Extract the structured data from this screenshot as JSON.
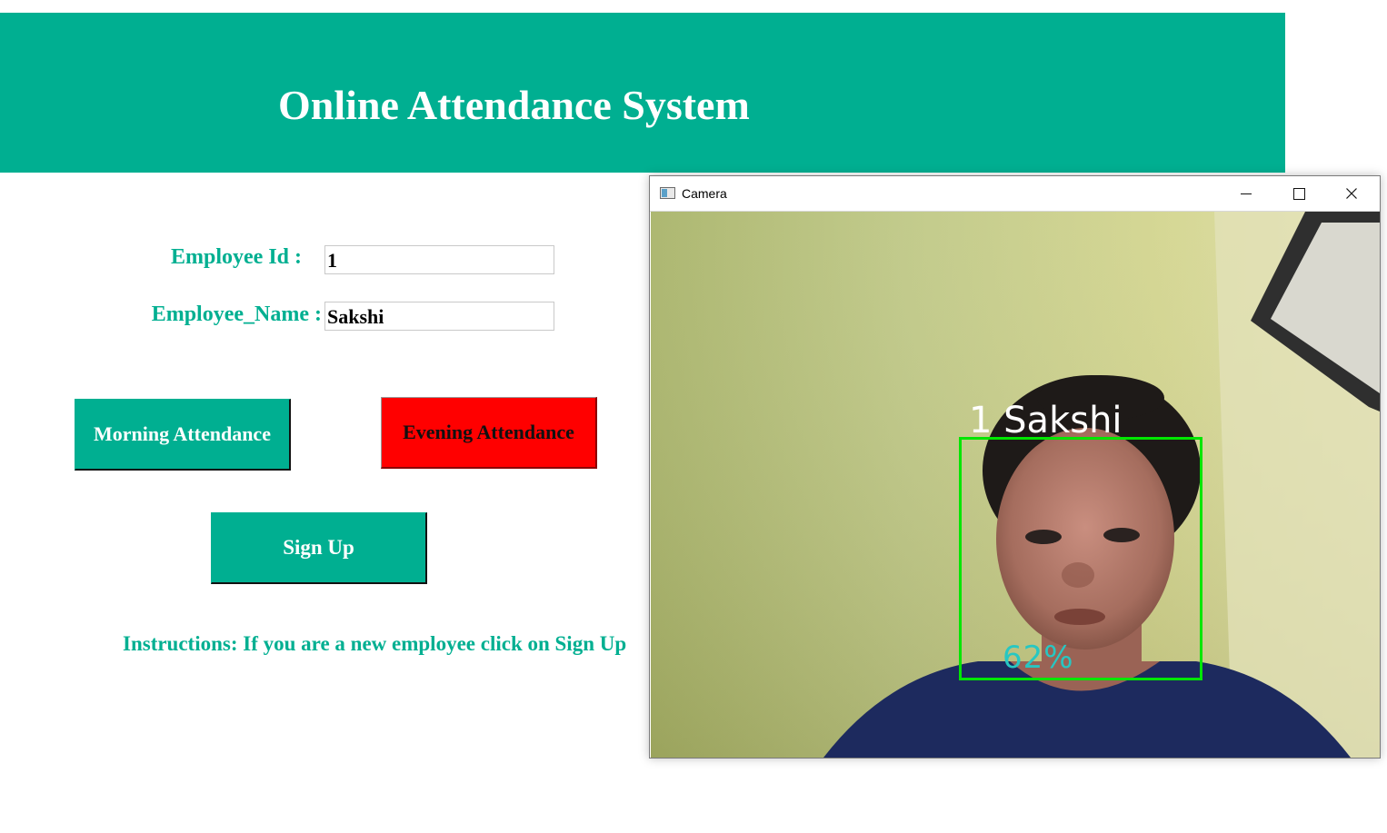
{
  "header": {
    "title": "Online Attendance System"
  },
  "form": {
    "employee_id_label": "Employee Id :",
    "employee_id_value": "1",
    "employee_name_label": "Employee_Name :",
    "employee_name_value": "Sakshi"
  },
  "buttons": {
    "morning": "Morning Attendance",
    "evening": "Evening Attendance",
    "signup": "Sign Up"
  },
  "instructions": "Instructions: If you are a new employee click on Sign Up",
  "camera_window": {
    "title": "Camera",
    "app_icon": "window-app-icon",
    "controls": [
      "minimize-icon",
      "maximize-icon",
      "close-icon"
    ],
    "detection": {
      "id": "1",
      "name": "Sakshi",
      "label": "1  Sakshi",
      "confidence": "62%"
    }
  },
  "colors": {
    "accent": "#00af91",
    "evening_button": "#ff0000",
    "box_green": "#00e600",
    "confidence_text": "#27c7c2"
  }
}
